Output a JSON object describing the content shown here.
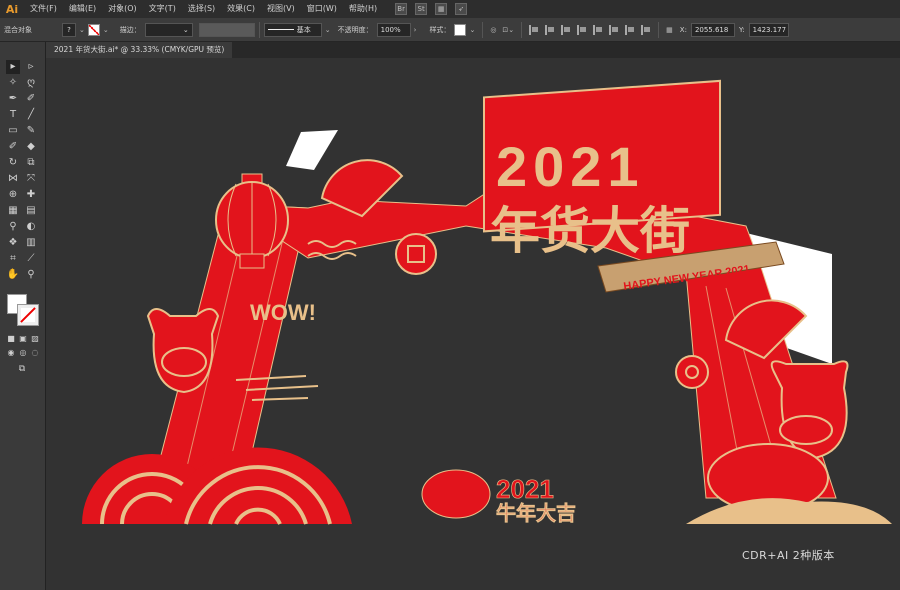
{
  "app": {
    "logo": "Ai"
  },
  "menu": [
    "文件(F)",
    "编辑(E)",
    "对象(O)",
    "文字(T)",
    "选择(S)",
    "效果(C)",
    "视图(V)",
    "窗口(W)",
    "帮助(H)"
  ],
  "menu_icons": [
    "Br",
    "St"
  ],
  "control_bar": {
    "selection_label": "混合对象",
    "fill_value": "?",
    "stroke_label": "描边：",
    "stroke_style": "基本",
    "opacity_label": "不透明度：",
    "opacity_value": "100%",
    "style_label": "样式：",
    "x_label": "X:",
    "x_value": "2055.618",
    "y_label": "Y:",
    "y_value": "1423.177"
  },
  "document": {
    "tab_title": "2021 年货大街.ai* @ 33.33% (CMYK/GPU 预览)"
  },
  "artwork": {
    "year": "2021",
    "title": "年货大街",
    "ribbon": "HAPPY NEW YEAR 2021",
    "wow": "WOW!",
    "badge_year": "2021",
    "badge_text": "牛年大吉"
  },
  "caption": "CDR+AI 2种版本",
  "colors": {
    "red": "#e2141c",
    "gold": "#e8c08a",
    "dark_bg": "#323232",
    "white_panel": "#ffffff"
  }
}
